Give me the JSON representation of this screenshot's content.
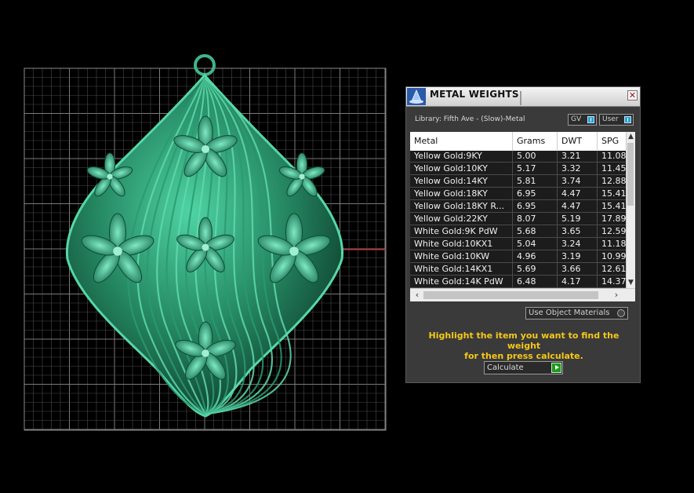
{
  "panel": {
    "title": "METAL WEIGHTS",
    "close_glyph": "✕",
    "library_label": "Library: Fifth Ave - (Slow)-Metal",
    "toggle_gv": "GV",
    "toggle_user": "User",
    "columns": [
      "Metal",
      "Grams",
      "DWT",
      "SPG"
    ],
    "rows": [
      [
        "Yellow Gold:9KY",
        "5.00",
        "3.21",
        "11.08"
      ],
      [
        "Yellow Gold:10KY",
        "5.17",
        "3.32",
        "11.45"
      ],
      [
        "Yellow Gold:14KY",
        "5.81",
        "3.74",
        "12.88"
      ],
      [
        "Yellow Gold:18KY",
        "6.95",
        "4.47",
        "15.41"
      ],
      [
        "Yellow Gold:18KY R...",
        "6.95",
        "4.47",
        "15.41"
      ],
      [
        "Yellow Gold:22KY",
        "8.07",
        "5.19",
        "17.89"
      ],
      [
        "White Gold:9K PdW",
        "5.68",
        "3.65",
        "12.59"
      ],
      [
        "White Gold:10KX1",
        "5.04",
        "3.24",
        "11.18"
      ],
      [
        "White Gold:10KW",
        "4.96",
        "3.19",
        "10.99"
      ],
      [
        "White Gold:14KX1",
        "5.69",
        "3.66",
        "12.61"
      ],
      [
        "White Gold:14K PdW",
        "6.48",
        "4.17",
        "14.37"
      ]
    ],
    "use_object_materials": "Use Object Materials",
    "hint_line1": "Highlight the item you want to find the weight",
    "hint_line2": "for then press calculate.",
    "calculate": "Calculate",
    "colors": {
      "accent": "#f5c816",
      "model": "#2f9a72",
      "axis": "#cc2020"
    }
  }
}
